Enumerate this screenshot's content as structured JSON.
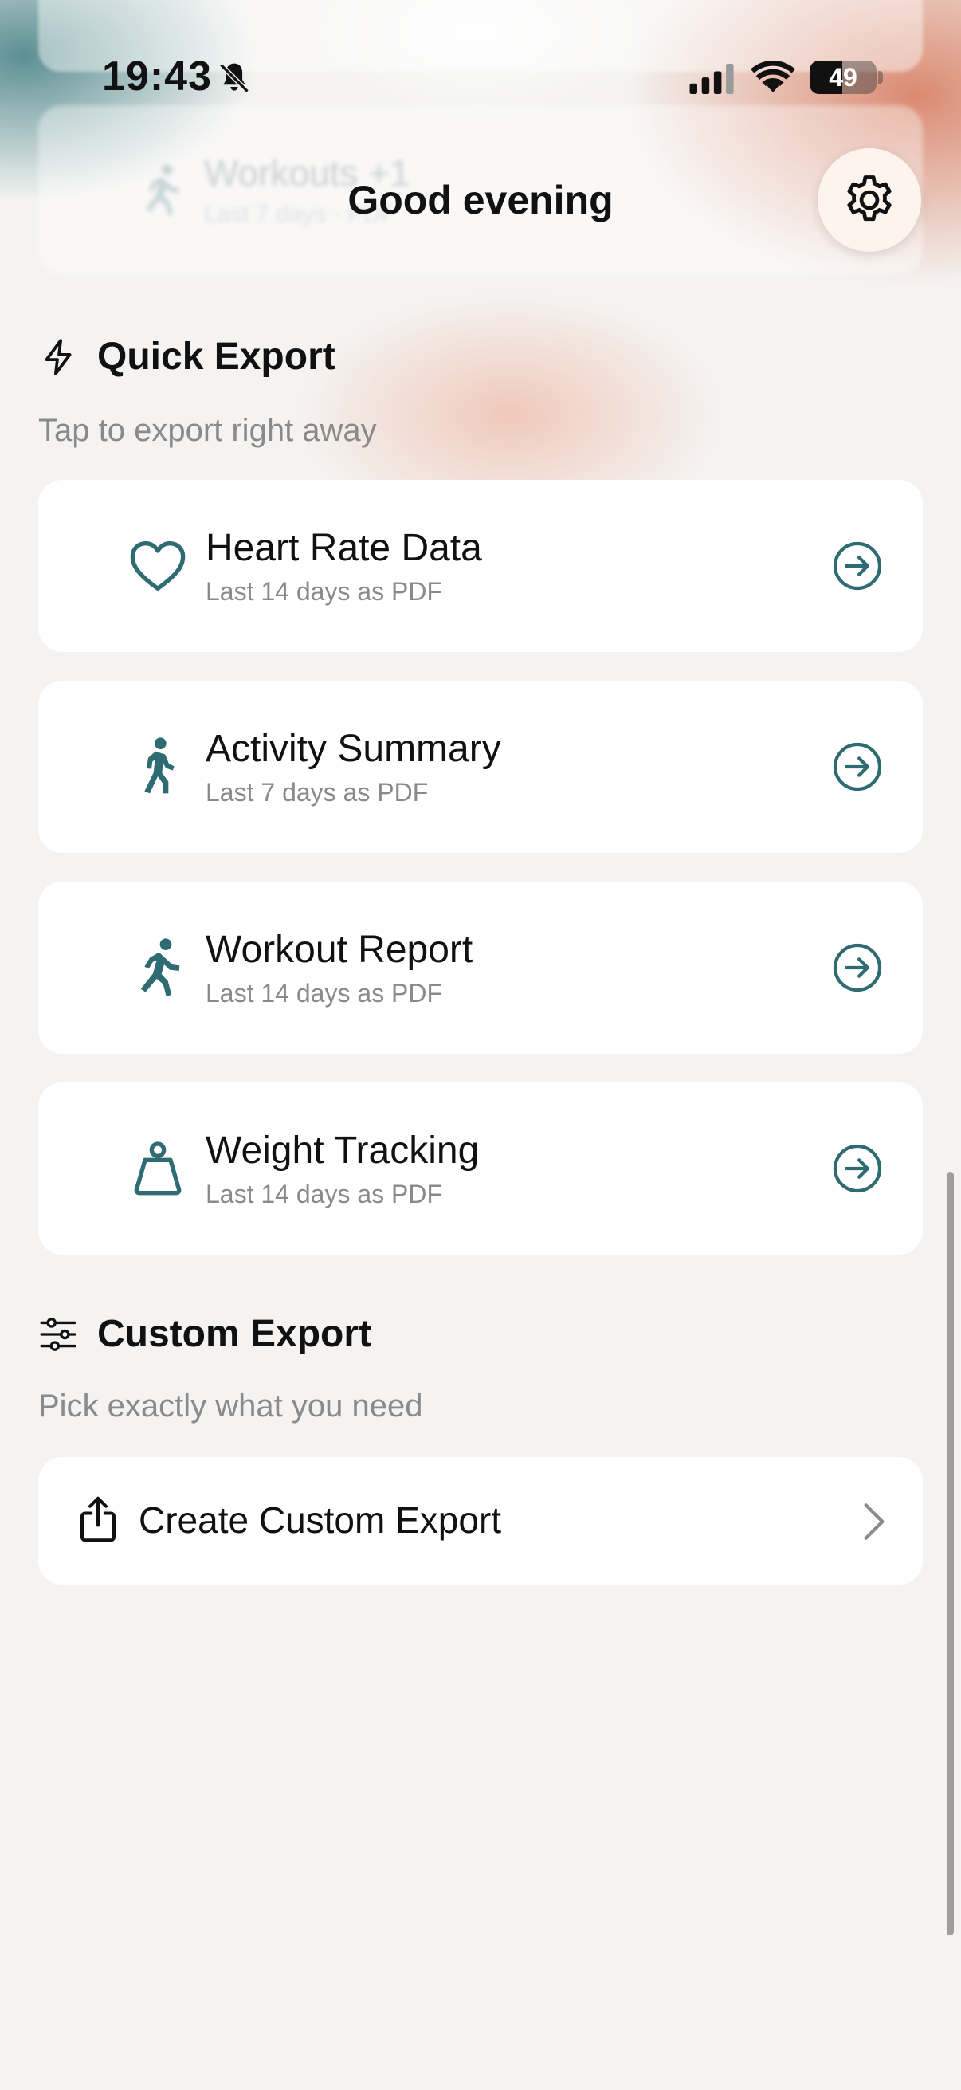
{
  "status_bar": {
    "time": "19:43",
    "battery_percent": "49",
    "battery_level": 0.49
  },
  "header": {
    "greeting": "Good evening",
    "settings_icon": "gear-icon"
  },
  "background_peek": {
    "title": "Workouts +1",
    "subtitle": "Last 7 days · PDF"
  },
  "quick_export": {
    "title": "Quick Export",
    "subtitle": "Tap to export right away",
    "icon": "lightning-icon",
    "items": [
      {
        "title": "Heart Rate Data",
        "subtitle": "Last 14 days as PDF",
        "icon": "heart-icon"
      },
      {
        "title": "Activity Summary",
        "subtitle": "Last 7 days as PDF",
        "icon": "walking-icon"
      },
      {
        "title": "Workout Report",
        "subtitle": "Last 14 days as PDF",
        "icon": "running-icon"
      },
      {
        "title": "Weight Tracking",
        "subtitle": "Last 14 days as PDF",
        "icon": "weight-icon"
      }
    ]
  },
  "custom_export": {
    "title": "Custom Export",
    "subtitle": "Pick exactly what you need",
    "icon": "sliders-icon",
    "button_label": "Create Custom Export"
  },
  "colors": {
    "accent": "#2f6b72",
    "background": "#f4f3f1",
    "card": "#ffffff",
    "muted_text": "#8a8a8a"
  }
}
